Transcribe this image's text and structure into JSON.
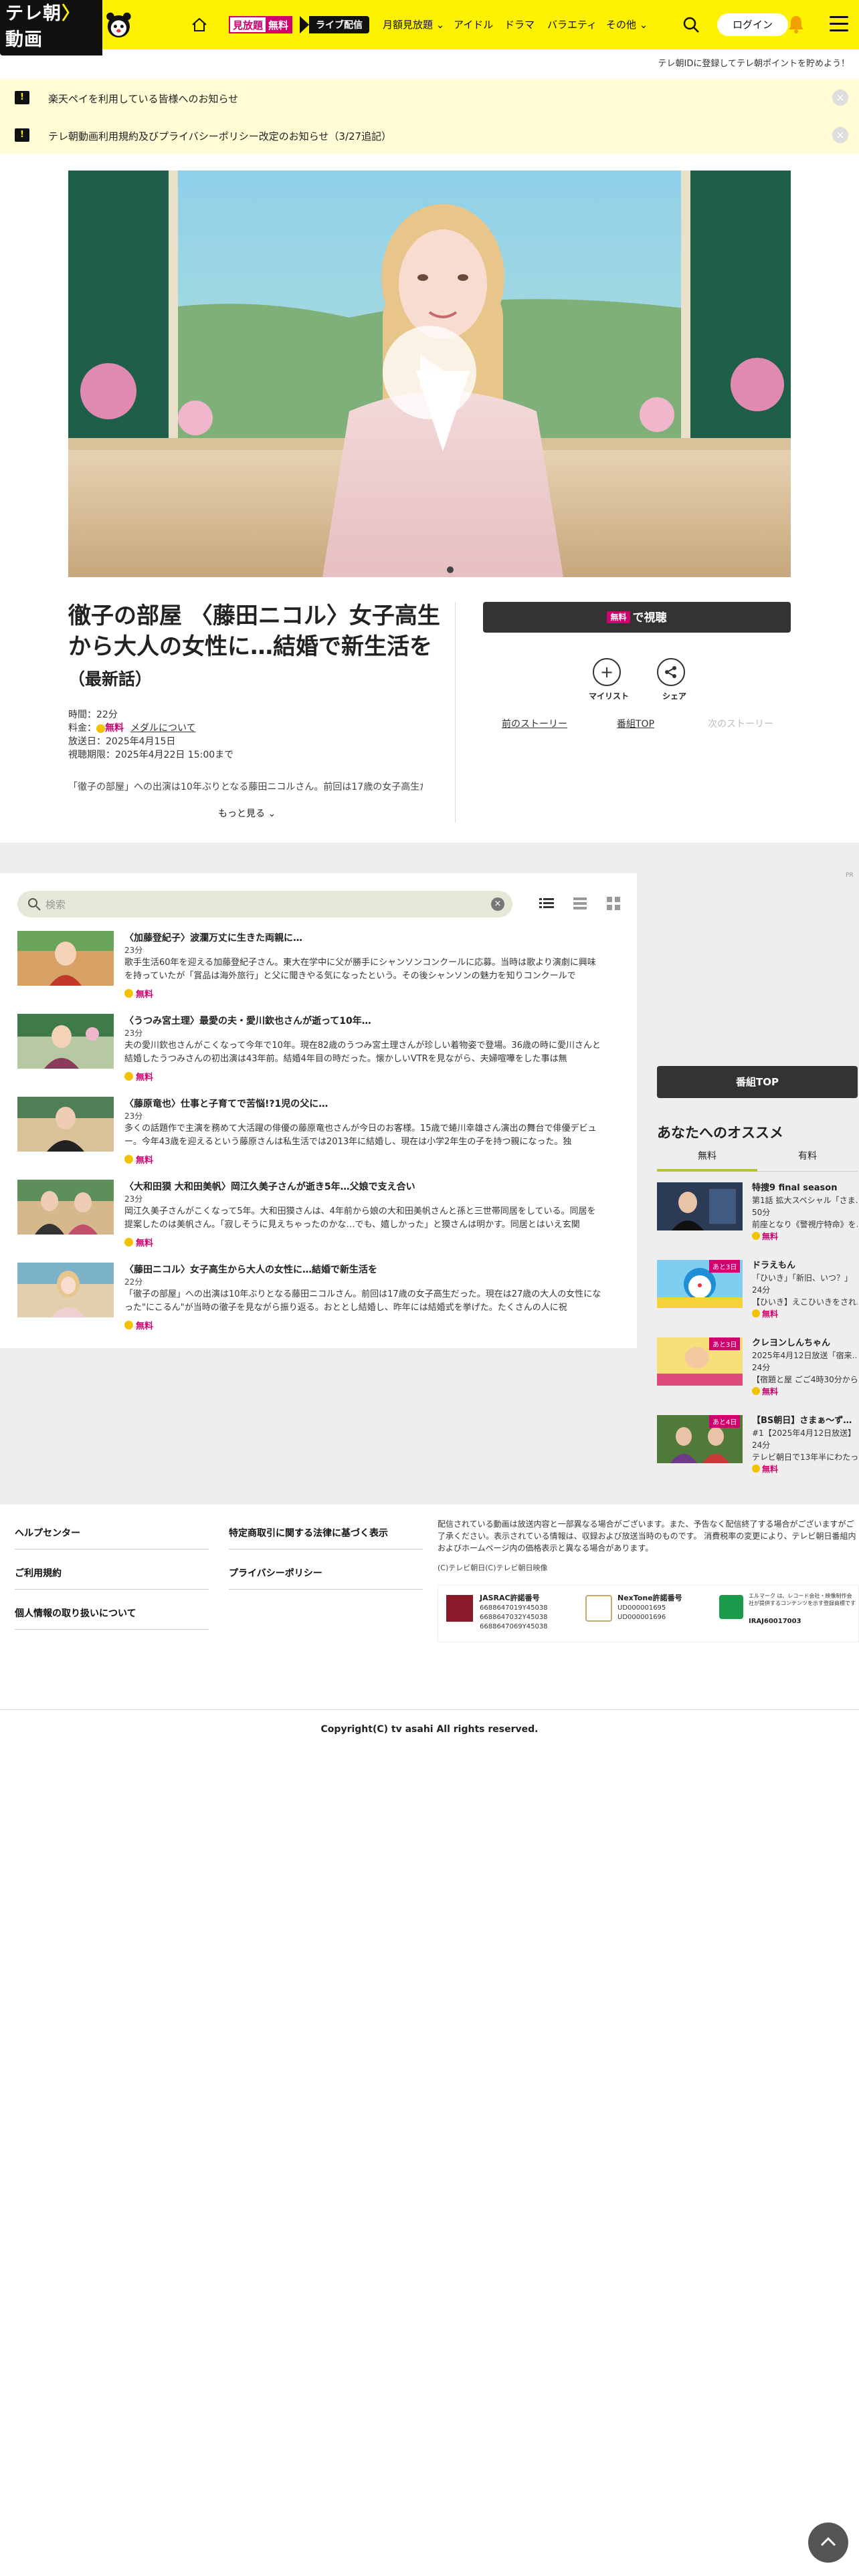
{
  "header": {
    "logo_text": "テレ朝",
    "logo_text2": "動画",
    "badge_mihodai_1": "見放題",
    "badge_mihodai_2": "無料",
    "badge_live": "ライブ配信",
    "nav": [
      "月額見放題",
      "アイドル",
      "ドラマ",
      "バラエティ",
      "その他"
    ],
    "login": "ログイン"
  },
  "subbar_text": "テレ朝IDに登録してテレ朝ポイントを貯めよう！",
  "notices": [
    "楽天ペイを利用している皆様へのお知らせ",
    "テレ朝動画利用規約及びプライバシーポリシー改定のお知らせ（3/27追記）"
  ],
  "episode": {
    "title": "徹子の部屋 〈藤田ニコル〉女子高生から大人の女性に…結婚で新生活を",
    "title_sub": "（最新話）",
    "duration": "時間：22分",
    "price_label": "料金：",
    "price_free": "無料",
    "medal_link": "メダルについて",
    "air_date": "放送日：2025年4月15日",
    "expiry": "視聴期限：2025年4月22日 15:00まで",
    "desc": "「徹子の部屋」への出演は10年ぶりとなる藤田ニコルさん。前回は17歳の女子高生だっ",
    "more": "もっと見る"
  },
  "actions": {
    "watch_free": "無料",
    "watch_label": "で視聴",
    "mylist": "マイリスト",
    "share": "シェア",
    "prev_story": "前のストーリー",
    "program_top": "番組TOP",
    "next_story": "次のストーリー"
  },
  "list": {
    "search_placeholder": "検索",
    "items": [
      {
        "title": "〈加藤登紀子〉波瀾万丈に生きた両親に…",
        "duration": "23分",
        "desc": "歌手生活60年を迎える加藤登紀子さん。東大在学中に父が勝手にシャンソンコンクールに応募。当時は歌より演劇に興味を持っていたが「賞品は海外旅行」と父に聞きやる気になったという。その後シャンソンの魅力を知りコンクールで",
        "free": "無料"
      },
      {
        "title": "〈うつみ宮土理〉最愛の夫・愛川欽也さんが逝って10年…",
        "duration": "23分",
        "desc": "夫の愛川欽也さんがこくなって今年で10年。現在82歳のうつみ宮土理さんが珍しい着物姿で登場。36歳の時に愛川さんと結婚したうつみさんの初出演は43年前。結婚4年目の時だった。懐かしいVTRを見ながら、夫婦喧嘩をした事は無",
        "free": "無料"
      },
      {
        "title": "〈藤原竜也〉仕事と子育てで苦悩!?1児の父に…",
        "duration": "23分",
        "desc": "多くの話題作で主演を務めて大活躍の俳優の藤原竜也さんが今日のお客様。15歳で蜷川幸雄さん演出の舞台で俳優デビュー。今年43歳を迎えるという藤原さんは私生活では2013年に結婚し、現在は小学2年生の子を持つ親になった。独",
        "free": "無料"
      },
      {
        "title": "〈大和田獏 大和田美帆〉岡江久美子さんが逝き5年…父娘で支え合い",
        "duration": "23分",
        "desc": "岡江久美子さんがこくなって5年。大和田獏さんは、4年前から娘の大和田美帆さんと孫と三世帯同居をしている。同居を提案したのは美帆さん。「寂しそうに見えちゃったのかな…でも、嬉しかった」と獏さんは明かす。同居とはいえ玄関",
        "free": "無料"
      },
      {
        "title": "〈藤田ニコル〉女子高生から大人の女性に…結婚で新生活を",
        "duration": "22分",
        "desc": "「徹子の部屋」への出演は10年ぶりとなる藤田ニコルさん。前回は17歳の女子高生だった。現在は27歳の大人の女性になった\"にこるん\"が当時の徹子を見ながら振り返る。おととし結婚し、昨年には結婚式を挙げた。たくさんの人に祝",
        "free": "無料"
      }
    ]
  },
  "sidebar": {
    "ad_tag": "PR",
    "program_top": "番組TOP",
    "rec_title": "あなたへのオススメ",
    "tab_free": "無料",
    "tab_paid": "有料",
    "recs": [
      {
        "thumb_text": "特捜9",
        "tag": "",
        "title": "特捜9 final season",
        "sub1": "第1話 拡大スペシャル「さま…",
        "sub2": "50分",
        "sub3": "前座となり《警視庁特命》を…",
        "free": "無料"
      },
      {
        "thumb_text": "ドラえもん",
        "tag": "あと3日",
        "title": "ドラえもん",
        "sub1": "「ひいき」「新旧、いつ？」",
        "sub2": "24分",
        "sub3": "【ひいき】えこひいきをされ…",
        "free": "無料"
      },
      {
        "thumb_text": "クレヨンしんちゃん",
        "tag": "あと3日",
        "title": "クレヨンしんちゃん",
        "sub1": "2025年4月12日放送「宿来…",
        "sub2": "24分",
        "sub3": "【宿題と屋 ごご4時30分から…",
        "free": "無料"
      },
      {
        "thumb_text": "BS朝日",
        "tag": "あと4日",
        "title": "【BS朝日】さまぁ〜ず…",
        "sub1": "#1【2025年4月12日放送】",
        "sub2": "24分",
        "sub3": "テレビ朝日で13年半にわたっ…",
        "free": "無料"
      }
    ]
  },
  "footer": {
    "links_left": [
      "ヘルプセンター",
      "ご利用規約",
      "個人情報の取り扱いについて"
    ],
    "links_mid": [
      "特定商取引に関する法律に基づく表示",
      "プライバシーポリシー"
    ],
    "note": "配信されている動画は放送内容と一部異なる場合がございます。また、予告なく配信終了する場合がございますがご了承ください。表示されている情報は、収録および放送当時のものです。 消費税率の変更により、テレビ朝日番組内およびホームページ内の価格表示と異なる場合があります。",
    "copy_small": "(C)テレビ朝日(C)テレビ朝日映像",
    "jasrac_title": "JASRAC許諾番号",
    "jasrac_nums": [
      "6688647019Y45038",
      "6688647032Y45038",
      "6688647069Y45038"
    ],
    "nextone_title": "NexTone許諾番号",
    "nextone_nums": [
      "UD000001695",
      "UD000001696"
    ],
    "riaj_text": "エルマーク は、レコード会社・映像制作会社が提供するコンテンツを示す登録商標です",
    "riaj_num": "IRAJ60017003",
    "copyright": "Copyright(C) tv asahi All rights reserved."
  },
  "colors": {
    "brand_yellow": "#fff200",
    "free_pink": "#d0006f",
    "dark_button": "#333333",
    "tab_underline": "#b9c42a"
  }
}
